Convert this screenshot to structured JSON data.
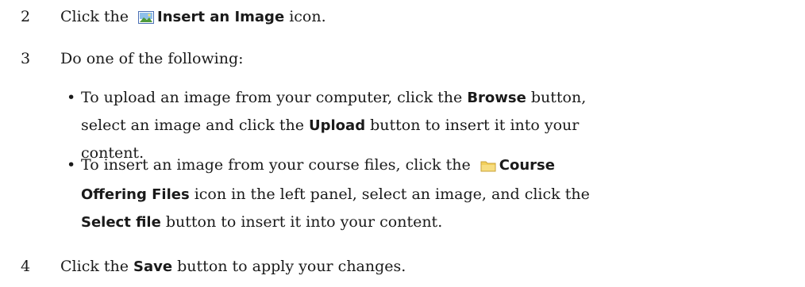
{
  "steps": [
    {
      "number": "2",
      "pre": "Click the ",
      "ui_label": "Insert an Image",
      "post": " icon.",
      "icon": "image-icon"
    },
    {
      "number": "3",
      "text": "Do one of the following:"
    },
    {
      "number": "4",
      "pre": "Click the ",
      "ui_label": "Save",
      "post": " button to apply your changes."
    }
  ],
  "bullets": [
    {
      "bullet": "•",
      "pre": "To upload an image from your computer, click the ",
      "ui1": "Browse",
      "mid": " button, select an image and click the ",
      "ui2": "Upload",
      "post": " button to insert it into your content."
    },
    {
      "bullet": "•",
      "pre": "To insert an image from your course files, click the ",
      "ui1": "Course Offering Files",
      "mid": " icon in the left panel, select an image, and click the ",
      "ui2": "Select file",
      "post": " button to insert it into your content.",
      "icon": "folder-icon"
    }
  ],
  "colors": {
    "image_icon_frame": "#4a6fb5",
    "image_icon_sky": "#8fc0ea",
    "image_icon_ground": "#4f9a3c",
    "folder_icon": "#f2cf5b"
  }
}
